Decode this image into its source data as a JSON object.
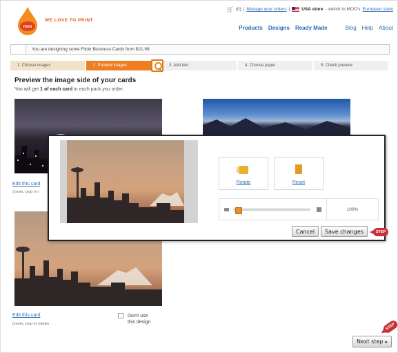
{
  "header": {
    "brand_logo": "moo",
    "brand_tagline": "WE LOVE TO PRINT",
    "cart_count": "(0)",
    "manage_orders": "Manage your orders",
    "store_label": "USA store",
    "switch_text": "- switch to MOO's",
    "european_store": "European store"
  },
  "nav": {
    "products": "Products",
    "designs": "Designs",
    "ready_made": "Ready Made",
    "blog": "Blog",
    "help": "Help",
    "about": "About"
  },
  "designing_text": "You are designing some Flickr Business Cards from $21.99",
  "steps": [
    {
      "label": "1. Choose images"
    },
    {
      "label": "2. Preview images"
    },
    {
      "label": "3. Add text"
    },
    {
      "label": "4. Choose paper"
    },
    {
      "label": "5. Check preview"
    }
  ],
  "preview": {
    "heading": "Preview the image side of your cards",
    "sub_pre": "You will get",
    "sub_bold": "1 of each card",
    "sub_post": "in each pack you order."
  },
  "cards": {
    "edit_link": "Edit this card",
    "edit_note": "(zoom, crop or rotate)",
    "edit_link_top": "Edit this card",
    "edit_note_top": "(zoom, crop or r",
    "dont_use_line1": "Don't use",
    "dont_use_line2": "this design"
  },
  "modal": {
    "rotate": "Rotate",
    "reset": "Reset",
    "zoom_value": "100%",
    "zoom_level": 0.05,
    "cancel": "Cancel",
    "save": "Save changes",
    "badge": "STEP"
  },
  "footer": {
    "next_step": "Next step",
    "badge": "STEP"
  },
  "colors": {
    "accent": "#ef7d22",
    "link": "#2f6fb5",
    "badge": "#c7323a"
  }
}
